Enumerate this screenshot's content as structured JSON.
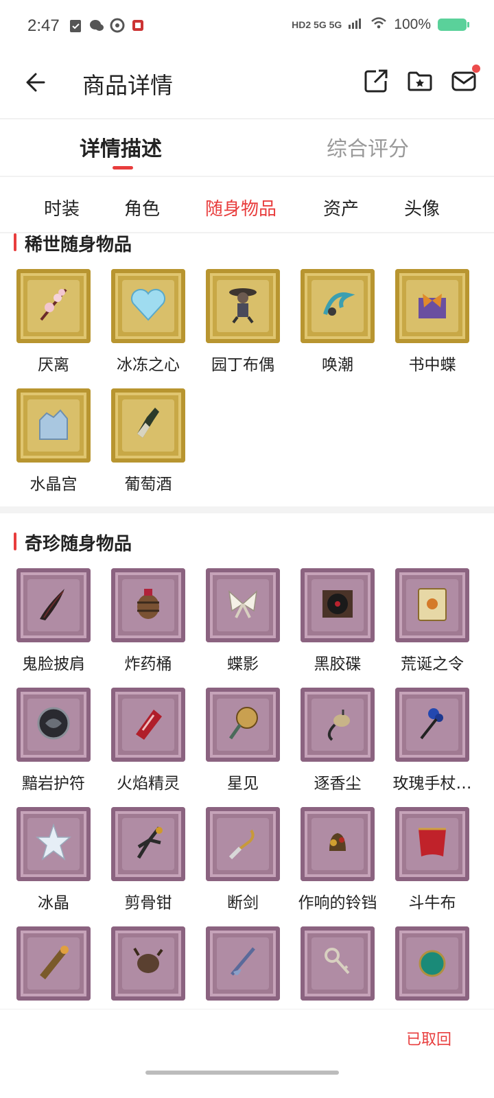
{
  "status_bar": {
    "time": "2:47",
    "network": "HD2 5G 5G",
    "battery": "100%"
  },
  "header": {
    "title": "商品详情"
  },
  "main_tabs": [
    {
      "label": "详情描述",
      "active": true
    },
    {
      "label": "综合评分",
      "active": false
    }
  ],
  "sub_tabs": [
    {
      "label": "时装",
      "active": false
    },
    {
      "label": "角色",
      "active": false
    },
    {
      "label": "随身物品",
      "active": true
    },
    {
      "label": "资产",
      "active": false
    },
    {
      "label": "头像",
      "active": false
    }
  ],
  "rare_section": {
    "title": "稀世随身物品",
    "items": [
      {
        "label": "厌离",
        "icon": "blossom-branch-icon"
      },
      {
        "label": "冰冻之心",
        "icon": "ice-heart-icon"
      },
      {
        "label": "园丁布偶",
        "icon": "gardener-doll-icon"
      },
      {
        "label": "唤潮",
        "icon": "tide-icon"
      },
      {
        "label": "书中蝶",
        "icon": "book-butterfly-icon"
      },
      {
        "label": "水晶宫",
        "icon": "crystal-palace-icon"
      },
      {
        "label": "葡萄酒",
        "icon": "wine-bottle-icon"
      }
    ]
  },
  "treasure_section": {
    "title": "奇珍随身物品",
    "items": [
      {
        "label": "鬼脸披肩",
        "icon": "shawl-icon"
      },
      {
        "label": "炸药桶",
        "icon": "powder-keg-icon"
      },
      {
        "label": "蝶影",
        "icon": "butterfly-icon"
      },
      {
        "label": "黑胶碟",
        "icon": "vinyl-record-icon"
      },
      {
        "label": "荒诞之令",
        "icon": "card-icon"
      },
      {
        "label": "黯岩护符",
        "icon": "amulet-icon"
      },
      {
        "label": "火焰精灵",
        "icon": "flame-crystal-icon"
      },
      {
        "label": "星见",
        "icon": "star-mirror-icon"
      },
      {
        "label": "逐香尘",
        "icon": "incense-icon"
      },
      {
        "label": "玫瑰手杖…",
        "icon": "rose-cane-icon"
      },
      {
        "label": "冰晶",
        "icon": "ice-crystal-icon"
      },
      {
        "label": "剪骨钳",
        "icon": "pliers-icon"
      },
      {
        "label": "断剑",
        "icon": "broken-sword-icon"
      },
      {
        "label": "作响的铃铛",
        "icon": "bell-icon"
      },
      {
        "label": "斗牛布",
        "icon": "red-cape-icon"
      },
      {
        "label": "",
        "icon": "spyglass-icon"
      },
      {
        "label": "",
        "icon": "mechanism-icon"
      },
      {
        "label": "",
        "icon": "feather-pen-icon"
      },
      {
        "label": "",
        "icon": "key-icon"
      },
      {
        "label": "",
        "icon": "emerald-icon"
      }
    ]
  },
  "footer": {
    "status": "已取回"
  },
  "colors": {
    "accent": "#e83d3d",
    "gold_stamp": "#c8a846",
    "purple_stamp": "#a07a92"
  }
}
